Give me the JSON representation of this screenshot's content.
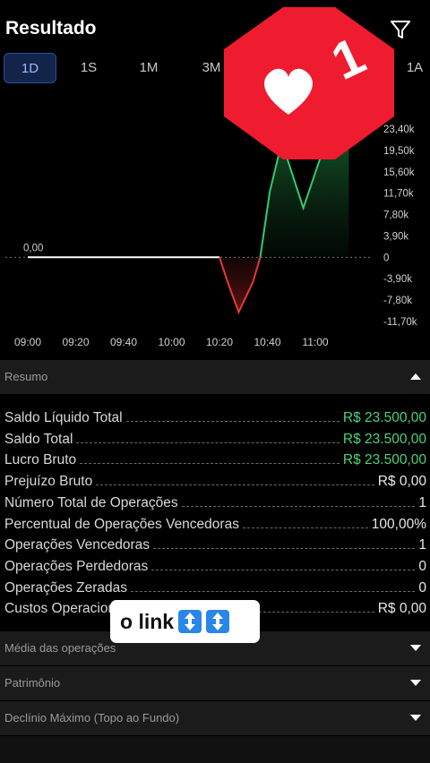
{
  "header": {
    "title": "Resultado",
    "filter_icon": "filter-icon"
  },
  "tabs": [
    {
      "label": "1D",
      "active": true
    },
    {
      "label": "1S",
      "active": false
    },
    {
      "label": "1M",
      "active": false
    },
    {
      "label": "3M",
      "active": false
    },
    {
      "label": "1A",
      "active": false
    }
  ],
  "notification": {
    "count": "1",
    "icon": "heart-icon",
    "color": "#ee1c2e"
  },
  "chart_data": {
    "type": "line",
    "x": [
      "09:00",
      "09:20",
      "09:40",
      "10:00",
      "10:20",
      "10:40",
      "11:00"
    ],
    "y_ticks": [
      "23,40k",
      "19,50k",
      "15,60k",
      "11,70k",
      "7,80k",
      "3,90k",
      "0",
      "-3,90k",
      "-7,80k",
      "-11,70k"
    ],
    "start_label": "0,00",
    "series": [
      {
        "points": [
          [
            "09:00",
            0
          ],
          [
            "09:20",
            0
          ],
          [
            "09:40",
            0
          ],
          [
            "10:00",
            0
          ],
          [
            "10:20",
            0
          ],
          [
            "10:23",
            -4000
          ],
          [
            "10:28",
            -10000
          ],
          [
            "10:34",
            -4500
          ],
          [
            "10:37",
            0
          ],
          [
            "10:41",
            12000
          ],
          [
            "10:46",
            21000
          ],
          [
            "10:55",
            9000
          ],
          [
            "11:02",
            18000
          ],
          [
            "11:08",
            23000
          ],
          [
            "11:14",
            23500
          ]
        ]
      }
    ],
    "ylim": [
      -11700,
      23400
    ],
    "colors": {
      "positive": "#2ecc71",
      "negative": "#e53935",
      "flat": "#ffffff",
      "grid": "#777777"
    }
  },
  "sections": {
    "resumo": "Resumo",
    "media": "Média das operações",
    "patrimonio": "Patrimônio",
    "declinio": "Declínio Máximo (Topo ao Fundo)"
  },
  "summary": [
    {
      "label": "Saldo Líquido Total",
      "value": "R$ 23.500,00",
      "green": true
    },
    {
      "label": "Saldo Total",
      "value": "R$ 23.500,00",
      "green": true
    },
    {
      "label": "Lucro Bruto",
      "value": "R$ 23.500,00",
      "green": true
    },
    {
      "label": "Prejuízo Bruto",
      "value": "R$ 0,00",
      "green": false
    },
    {
      "label": "Número Total de Operações",
      "value": "1",
      "green": false
    },
    {
      "label": "Percentual de Operações Vencedoras",
      "value": "100,00%",
      "green": false
    },
    {
      "label": "Operações Vencedoras",
      "value": "1",
      "green": false
    },
    {
      "label": "Operações Perdedoras",
      "value": "0",
      "green": false
    },
    {
      "label": "Operações Zeradas",
      "value": "0",
      "green": false
    },
    {
      "label": "Custos Operacionais",
      "value": "R$ 0,00",
      "green": false
    }
  ],
  "overlay": {
    "text": "o link",
    "icons": [
      "up-down-arrow-icon",
      "up-down-arrow-icon"
    ]
  }
}
